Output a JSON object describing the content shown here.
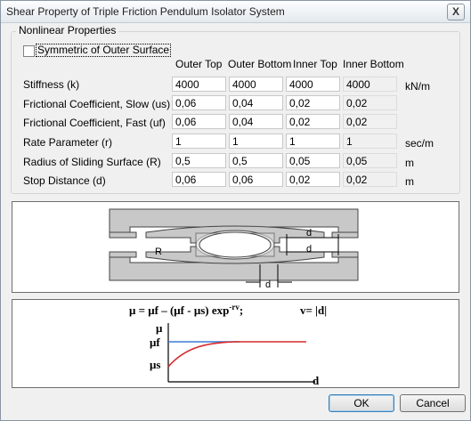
{
  "window": {
    "title": "Shear Property of Triple Friction Pendulum Isolator System",
    "close_glyph": "X"
  },
  "nonlinear": {
    "group_title": "Nonlinear Properties",
    "symmetric_label": "Symmetric of Outer Surface",
    "symmetric_checked": false
  },
  "columns": [
    "Outer Top",
    "Outer Bottom",
    "Inner Top",
    "Inner Bottom"
  ],
  "rows": [
    {
      "label": "Stiffness (k)",
      "values": [
        "4000",
        "4000",
        "4000",
        "4000"
      ],
      "unit": "kN/m"
    },
    {
      "label": "Frictional Coefficient, Slow (us)",
      "values": [
        "0,06",
        "0,04",
        "0,02",
        "0,02"
      ],
      "unit": ""
    },
    {
      "label": "Frictional Coefficient, Fast (uf)",
      "values": [
        "0,06",
        "0,04",
        "0,02",
        "0,02"
      ],
      "unit": ""
    },
    {
      "label": "Rate Parameter (r)",
      "values": [
        "1",
        "1",
        "1",
        "1"
      ],
      "unit": "sec/m"
    },
    {
      "label": "Radius of Sliding Surface (R)",
      "values": [
        "0,5",
        "0,5",
        "0,05",
        "0,05"
      ],
      "unit": "m"
    },
    {
      "label": "Stop Distance (d)",
      "values": [
        "0,06",
        "0,06",
        "0,02",
        "0,02"
      ],
      "unit": "m"
    }
  ],
  "diagram": {
    "label_R": "R",
    "label_d": "d"
  },
  "formula": {
    "mu_eq": "μ = μf – (μf - μs) exp",
    "mu_exp": "-rv",
    "mu_tail": ";",
    "v_eq": "v= |d|",
    "axis_mu": "μ",
    "axis_muf": "μf",
    "axis_mus": "μs",
    "axis_d": "d"
  },
  "buttons": {
    "ok": "OK",
    "cancel": "Cancel"
  },
  "colors": {
    "muf_line": "#3a7bd5",
    "mu_curve": "#d62a2a"
  }
}
